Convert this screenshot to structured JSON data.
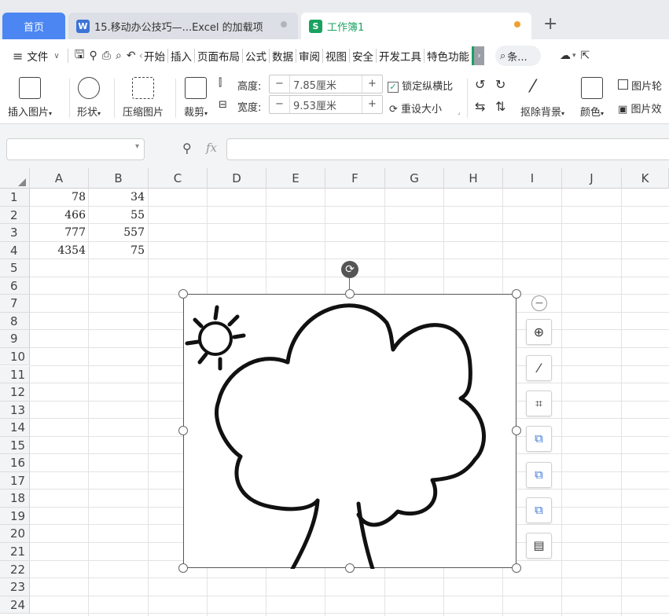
{
  "tabs": {
    "home": "首页",
    "doc": "15.移动办公技巧—...Excel 的加载项",
    "doc_badge": "W",
    "book": "工作簿1",
    "book_badge": "S",
    "new_tab": "+"
  },
  "menu": {
    "file": "文件",
    "items": [
      "开始",
      "插入",
      "页面布局",
      "公式",
      "数据",
      "审阅",
      "视图",
      "安全",
      "开发工具",
      "特色功能"
    ],
    "search": "条..."
  },
  "ribbon": {
    "insert_picture": "插入图片",
    "shape": "形状",
    "compress": "压缩图片",
    "crop": "裁剪",
    "height_label": "高度:",
    "height_value": "7.85厘米",
    "width_label": "宽度:",
    "width_value": "9.53厘米",
    "lock_ratio": "锁定纵横比",
    "reset_size": "重设大小",
    "remove_bg": "抠除背景",
    "color": "颜色",
    "picture_outline": "图片轮",
    "picture_effect": "图片效"
  },
  "formula": {
    "fx": "fx"
  },
  "columns": [
    "A",
    "B",
    "C",
    "D",
    "E",
    "F",
    "G",
    "H",
    "I",
    "J",
    "K"
  ],
  "rows": [
    "1",
    "2",
    "3",
    "4",
    "5",
    "6",
    "7",
    "8",
    "9",
    "10",
    "11",
    "12",
    "13",
    "14",
    "15",
    "16",
    "17",
    "18",
    "19",
    "20",
    "21",
    "22",
    "23",
    "24"
  ],
  "cells": {
    "a": [
      "78",
      "466",
      "777",
      "4354"
    ],
    "b": [
      "34",
      "55",
      "557",
      "75"
    ]
  },
  "colors": {
    "home_tab": "#4c86f2",
    "sheet_green": "#1aa260",
    "doc_blue": "#3b74d6",
    "unsaved_dot": "#f0a030"
  }
}
